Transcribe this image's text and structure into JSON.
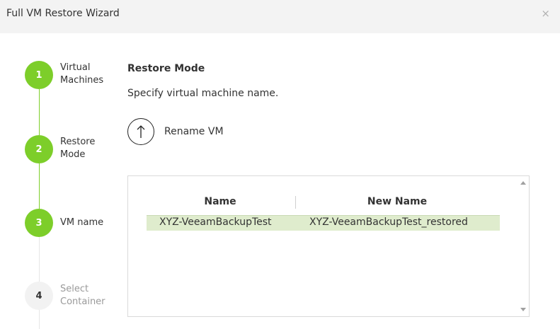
{
  "window": {
    "title": "Full VM Restore Wizard",
    "close_glyph": "×"
  },
  "steps": [
    {
      "number": "1",
      "label": "Virtual Machines",
      "state": "complete"
    },
    {
      "number": "2",
      "label": "Restore Mode",
      "state": "complete"
    },
    {
      "number": "3",
      "label": "VM name",
      "state": "current"
    },
    {
      "number": "4",
      "label": "Select Container",
      "state": "pending"
    }
  ],
  "main": {
    "title": "Restore Mode",
    "description": "Specify virtual machine name.",
    "rename_label": "Rename VM",
    "rename_icon": "arrow-up-icon"
  },
  "table": {
    "columns": [
      "Name",
      "New Name"
    ],
    "rows": [
      {
        "name": "XYZ-VeeamBackupTest",
        "new_name": "XYZ-VeeamBackupTest_restored",
        "selected": true
      }
    ]
  },
  "colors": {
    "accent": "#7dce2a",
    "selected_row": "#dfeccd"
  }
}
